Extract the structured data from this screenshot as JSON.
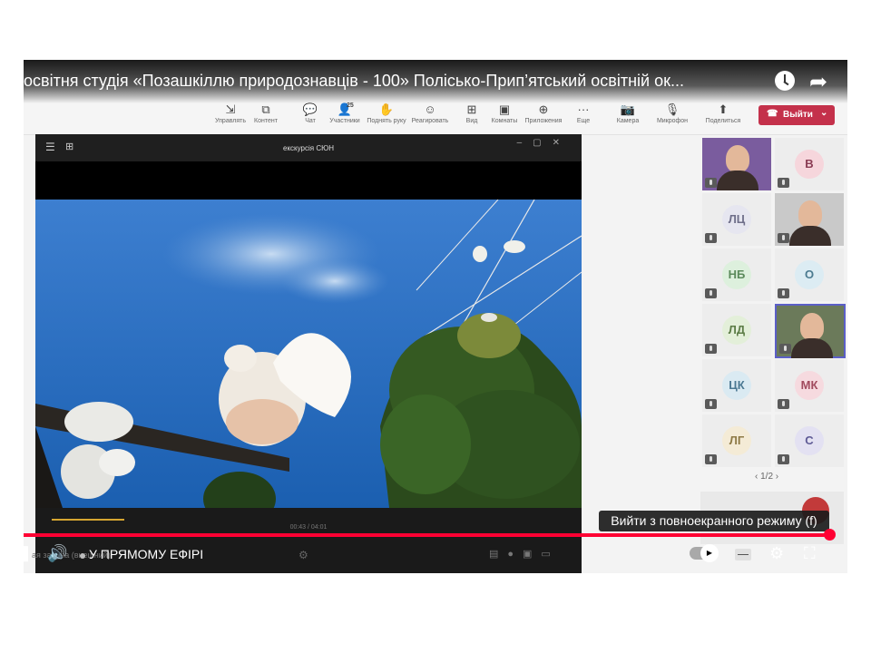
{
  "youtube": {
    "video_title": "освітня студія «Позашкіллю природознавців - 100» Полісько-Прип’ятський освітній ок...",
    "live_label": "У ПРЯМОМУ ЕФІРІ",
    "exit_fullscreen_tooltip": "Вийти з повноекранного режиму (f)",
    "progress_fraction": 0.98,
    "icons": {
      "watch_later": "clock-icon",
      "share": "share-arrow-icon",
      "volume": "speaker-icon",
      "settings": "gear-icon",
      "exit_fullscreen": "exit-fullscreen-icon"
    }
  },
  "teams": {
    "toolbar": [
      {
        "id": "manage",
        "label": "Управлять",
        "icon": "⇲"
      },
      {
        "id": "content",
        "label": "Контент",
        "icon": "⧉"
      },
      {
        "id": "chat",
        "label": "Чат",
        "icon": "💬"
      },
      {
        "id": "participants",
        "label": "Участники",
        "icon": "👤",
        "count": "25"
      },
      {
        "id": "raise-hand",
        "label": "Поднять руку",
        "icon": "✋"
      },
      {
        "id": "react",
        "label": "Реагировать",
        "icon": "☺"
      },
      {
        "id": "view",
        "label": "Вид",
        "icon": "⊞"
      },
      {
        "id": "rooms",
        "label": "Комнаты",
        "icon": "▣"
      },
      {
        "id": "apps",
        "label": "Приложения",
        "icon": "⊕"
      },
      {
        "id": "more",
        "label": "Еще",
        "icon": "···"
      },
      {
        "id": "camera",
        "label": "Камера",
        "icon": "📷"
      },
      {
        "id": "mic",
        "label": "Микрофон",
        "icon": "🎙"
      },
      {
        "id": "share",
        "label": "Поделиться",
        "icon": "⬆"
      }
    ],
    "leave_label": "Выйти",
    "shared_window_title": "екскурсія СЮН",
    "shared_footer_left": "ая задача (внешний)",
    "shared_time": "00:43 / 04:01",
    "pager": "1/2",
    "participants": [
      {
        "initials": "",
        "photo": true,
        "color": "#7a5c9e"
      },
      {
        "initials": "В",
        "color": "#f6d6dc",
        "text": "#8a3b53"
      },
      {
        "initials": "ЛЦ",
        "color": "#e6e6f0",
        "text": "#6f6f8a"
      },
      {
        "initials": "",
        "photo": true,
        "color": "#c9c9c9"
      },
      {
        "initials": "НБ",
        "color": "#ddf0dd",
        "text": "#5b8a5b"
      },
      {
        "initials": "О",
        "color": "#dcecf3",
        "text": "#4c7b90"
      },
      {
        "initials": "ЛД",
        "color": "#e3efd9",
        "text": "#5d7d47"
      },
      {
        "initials": "",
        "photo": true,
        "color": "#6b7a5a",
        "highlight": true
      },
      {
        "initials": "ЦК",
        "color": "#daeaf2",
        "text": "#4a7892"
      },
      {
        "initials": "МК",
        "color": "#f6dadf",
        "text": "#a14b5e"
      },
      {
        "initials": "ЛГ",
        "color": "#f4ebd6",
        "text": "#8e7a46"
      },
      {
        "initials": "С",
        "color": "#e3e1f2",
        "text": "#5f5b96"
      }
    ]
  }
}
